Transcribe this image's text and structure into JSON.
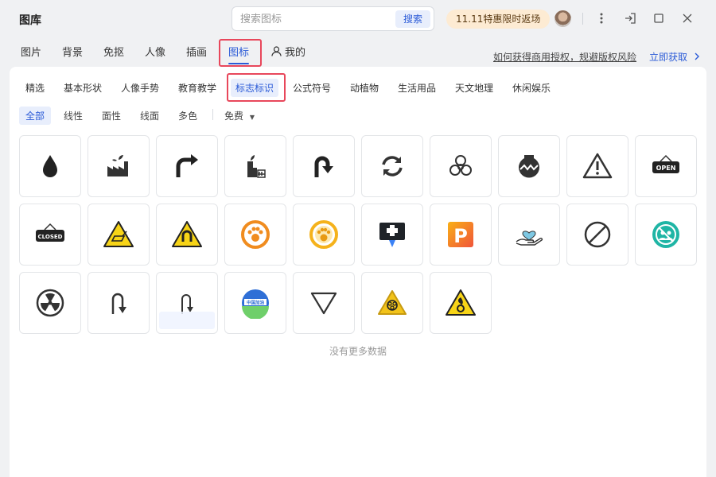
{
  "app": {
    "title": "图库"
  },
  "search": {
    "placeholder": "搜索图标",
    "button": "搜索"
  },
  "promo": "11.11特惠限时返场",
  "nav": {
    "tabs": [
      {
        "label": "图片"
      },
      {
        "label": "背景"
      },
      {
        "label": "免抠"
      },
      {
        "label": "人像"
      },
      {
        "label": "插画"
      },
      {
        "label": "图标"
      },
      {
        "label": "我的"
      }
    ],
    "active_tab": "图标",
    "license_link": "如何获得商用授权，规避版权风险",
    "get_link": "立即获取"
  },
  "categories": [
    "精选",
    "基本形状",
    "人像手势",
    "教育教学",
    "标志标识",
    "公式符号",
    "动植物",
    "生活用品",
    "天文地理",
    "休闲娱乐"
  ],
  "active_category": "标志标识",
  "filters": [
    "全部",
    "线性",
    "面性",
    "线面",
    "多色"
  ],
  "active_filter": "全部",
  "price_filter": "免费",
  "icons": [
    "water-drop-icon",
    "factory-icon",
    "turn-right-arrow-icon",
    "plant-city-icon",
    "u-turn-arrow-icon",
    "refresh-cycle-icon",
    "biohazard-icon",
    "pot-bomb-icon",
    "warning-triangle-icon",
    "open-sign-icon",
    "closed-sign-icon",
    "laser-warning-icon",
    "magnet-warning-icon",
    "paw-badge-orange-icon",
    "paw-badge-yellow-icon",
    "first-aid-flag-icon",
    "parking-p-icon",
    "hand-heart-icon",
    "prohibited-icon",
    "no-group-icon",
    "radiation-icon",
    "u-turn-down-icon",
    "u-turn-down-thin-icon",
    "china-refuel-badge-icon",
    "down-triangle-icon",
    "biohazard-warning-icon",
    "oxidizer-warning-icon"
  ],
  "sign_text": {
    "open": "OPEN",
    "closed": "CLOSED",
    "badge": "中国加油"
  },
  "parking_letter": "P",
  "empty_message": "没有更多数据",
  "colors": {
    "accent": "#2b5bd7",
    "highlight": "#e8475b",
    "warning_yellow": "#f7d417"
  }
}
